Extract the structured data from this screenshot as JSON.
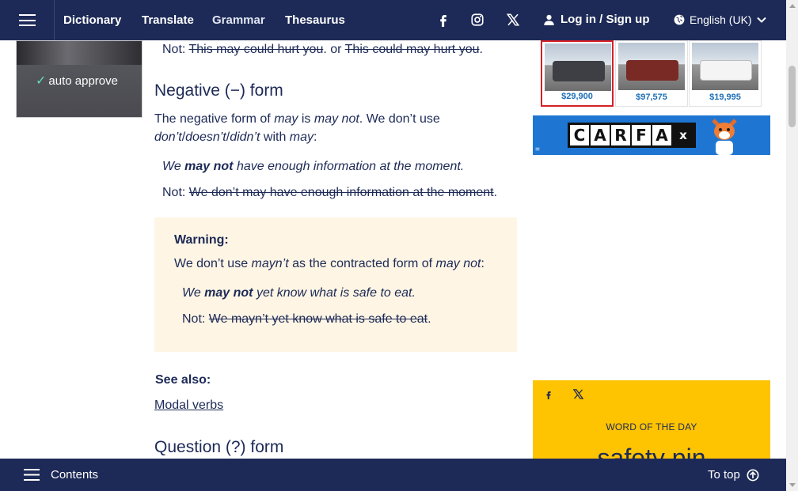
{
  "nav": {
    "links": [
      "Dictionary",
      "Translate",
      "Grammar",
      "Thesaurus"
    ],
    "login_label": "Log in / Sign up",
    "language": "English (UK)",
    "social_icons": [
      "facebook-icon",
      "instagram-icon",
      "x-icon"
    ]
  },
  "left_ad": {
    "brand": "auto approve"
  },
  "article": {
    "top_not": {
      "prefix": "Not:",
      "struck1": "This may could hurt you",
      "middle": ". or ",
      "struck2": "This could may hurt you",
      "suffix": "."
    },
    "negative_heading": "Negative (−) form",
    "negative_p1": {
      "a": "The negative form of ",
      "b": "may",
      "c": " is ",
      "d": "may not",
      "e": ". We don’t use"
    },
    "negative_p2": {
      "a": "don’t",
      "b": "/",
      "c": "doesn’t",
      "d": "/",
      "e": "didn’t",
      "f": " with ",
      "g": "may",
      "h": ":"
    },
    "example1": {
      "a": "We ",
      "b": "may not",
      "c": " have enough information at the moment."
    },
    "example1_not": {
      "prefix": "Not: ",
      "struck": "We don’t may have enough information at the moment",
      "suffix": "."
    },
    "warning": {
      "title": "Warning:",
      "text": {
        "a": "We don’t use ",
        "b": "mayn’t",
        "c": " as the contracted form of ",
        "d": "may not",
        "e": ":"
      },
      "example": {
        "a": "We ",
        "b": "may not",
        "c": " yet know what is safe to eat."
      },
      "not": {
        "prefix": "Not: ",
        "struck": "We mayn’t yet know what is safe to eat",
        "suffix": "."
      }
    },
    "see_also_label": "See also:",
    "see_also_link": "Modal verbs",
    "question_heading": "Question (?) form"
  },
  "car_ad": {
    "prices": [
      "$29,900",
      "$97,575",
      "$19,995"
    ],
    "brand_letters": [
      "C",
      "A",
      "R",
      "F",
      "A",
      "x"
    ],
    "ad_marker": "="
  },
  "wotd": {
    "label": "WORD OF THE DAY",
    "word": "safety pin"
  },
  "bottom": {
    "contents_label": "Contents",
    "to_top_label": "To top"
  },
  "colors": {
    "navy": "#1d2a57",
    "warning_bg": "#fef5e4",
    "wotd_yellow": "#fec301",
    "carfax_blue": "#1f76d2"
  }
}
